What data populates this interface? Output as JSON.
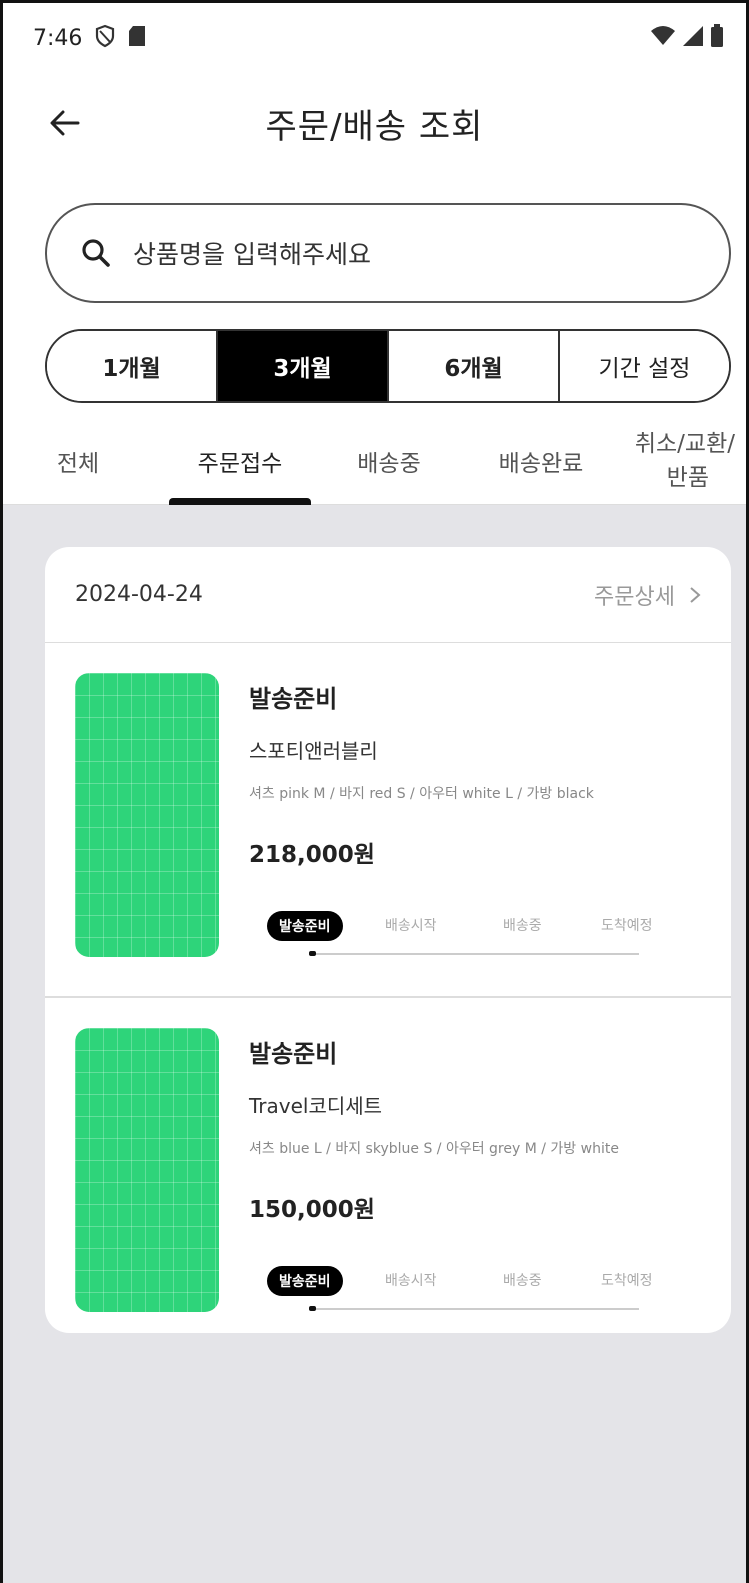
{
  "status_bar": {
    "time": "7:46",
    "icons": [
      "shield-icon",
      "sd-card-icon",
      "wifi-icon",
      "signal-icon",
      "battery-icon"
    ]
  },
  "header": {
    "title": "주문/배송 조회",
    "back_icon": "arrow-left-icon"
  },
  "search": {
    "placeholder": "상품명을 입력해주세요",
    "icon": "search-icon"
  },
  "period": {
    "options": [
      "1개월",
      "3개월",
      "6개월",
      "기간 설정"
    ],
    "selected": "3개월"
  },
  "tabs": {
    "items": [
      "전체",
      "주문접수",
      "배송중",
      "배송완료",
      "취소/교환/",
      "반품"
    ],
    "active": "주문접수"
  },
  "order": {
    "date": "2024-04-24",
    "detail_label": "주문상세",
    "items": [
      {
        "status": "발송준비",
        "name": "스포티앤러블리",
        "options": "셔츠 pink M / 바지 red S / 아우터 white L / 가방 black",
        "price": "218,000원",
        "steps": [
          "발송준비",
          "배송시작",
          "배송중",
          "도착예정"
        ],
        "progress": 0.02
      },
      {
        "status": "발송준비",
        "name": "Travel코디세트",
        "options": "셔츠 blue L / 바지 skyblue S / 아우터 grey M / 가방 white",
        "price": "150,000원",
        "steps": [
          "발송준비",
          "배송시작",
          "배송중",
          "도착예정"
        ],
        "progress": 0.02
      }
    ]
  },
  "colors": {
    "thumb": "#2ed47a",
    "selected": "#000000",
    "background": "#e4e4e8"
  }
}
